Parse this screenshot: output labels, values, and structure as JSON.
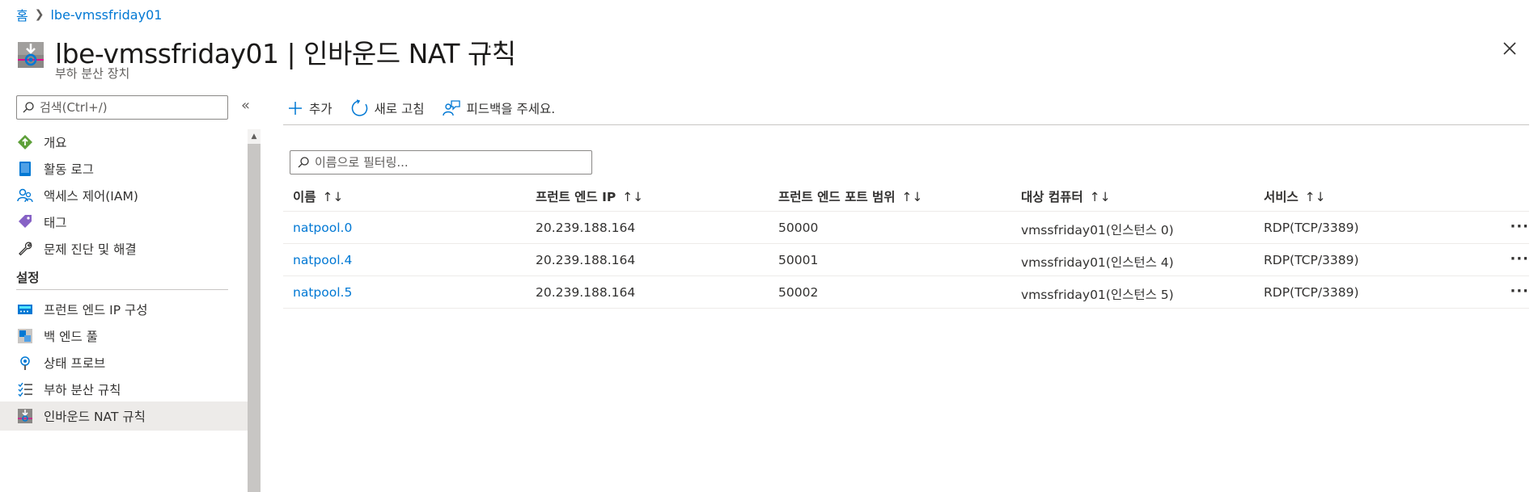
{
  "breadcrumb": {
    "home": "홈",
    "current": "lbe-vmssfriday01"
  },
  "header": {
    "title": "lbe-vmssfriday01 | 인바운드 NAT 규칙",
    "subtitle": "부하 분산 장치",
    "more": "···"
  },
  "sidebar": {
    "search_placeholder": "검색(Ctrl+/)",
    "collapse": "«",
    "items": [
      {
        "label": "개요",
        "icon": "overview-icon"
      },
      {
        "label": "활동 로그",
        "icon": "activity-log-icon"
      },
      {
        "label": "액세스 제어(IAM)",
        "icon": "access-control-icon"
      },
      {
        "label": "태그",
        "icon": "tag-icon"
      },
      {
        "label": "문제 진단 및 해결",
        "icon": "wrench-icon"
      }
    ],
    "section_settings": "설정",
    "settings_items": [
      {
        "label": "프런트 엔드 IP 구성",
        "icon": "frontend-ip-icon"
      },
      {
        "label": "백 엔드 풀",
        "icon": "backend-pool-icon"
      },
      {
        "label": "상태 프로브",
        "icon": "health-probe-icon"
      },
      {
        "label": "부하 분산 규칙",
        "icon": "lb-rules-icon"
      },
      {
        "label": "인바운드 NAT 규칙",
        "icon": "inbound-nat-icon",
        "active": true
      }
    ]
  },
  "toolbar": {
    "add": "추가",
    "refresh": "새로 고침",
    "feedback": "피드백을 주세요."
  },
  "filter": {
    "placeholder": "이름으로 필터링..."
  },
  "table": {
    "columns": [
      "이름",
      "프런트 엔드 IP",
      "프런트 엔드 포트 범위",
      "대상 컴퓨터",
      "서비스"
    ],
    "sort_glyph": "↑↓",
    "rows": [
      {
        "name": "natpool.0",
        "ip": "20.239.188.164",
        "port": "50000",
        "target": "vmssfriday01(인스턴스 0)",
        "service": "RDP(TCP/3389)"
      },
      {
        "name": "natpool.4",
        "ip": "20.239.188.164",
        "port": "50001",
        "target": "vmssfriday01(인스턴스 4)",
        "service": "RDP(TCP/3389)"
      },
      {
        "name": "natpool.5",
        "ip": "20.239.188.164",
        "port": "50002",
        "target": "vmssfriday01(인스턴스 5)",
        "service": "RDP(TCP/3389)"
      }
    ],
    "row_more": "···"
  },
  "colors": {
    "link": "#0078d4",
    "text": "#323130",
    "muted": "#605e5c",
    "active_bg": "#edebe9"
  }
}
